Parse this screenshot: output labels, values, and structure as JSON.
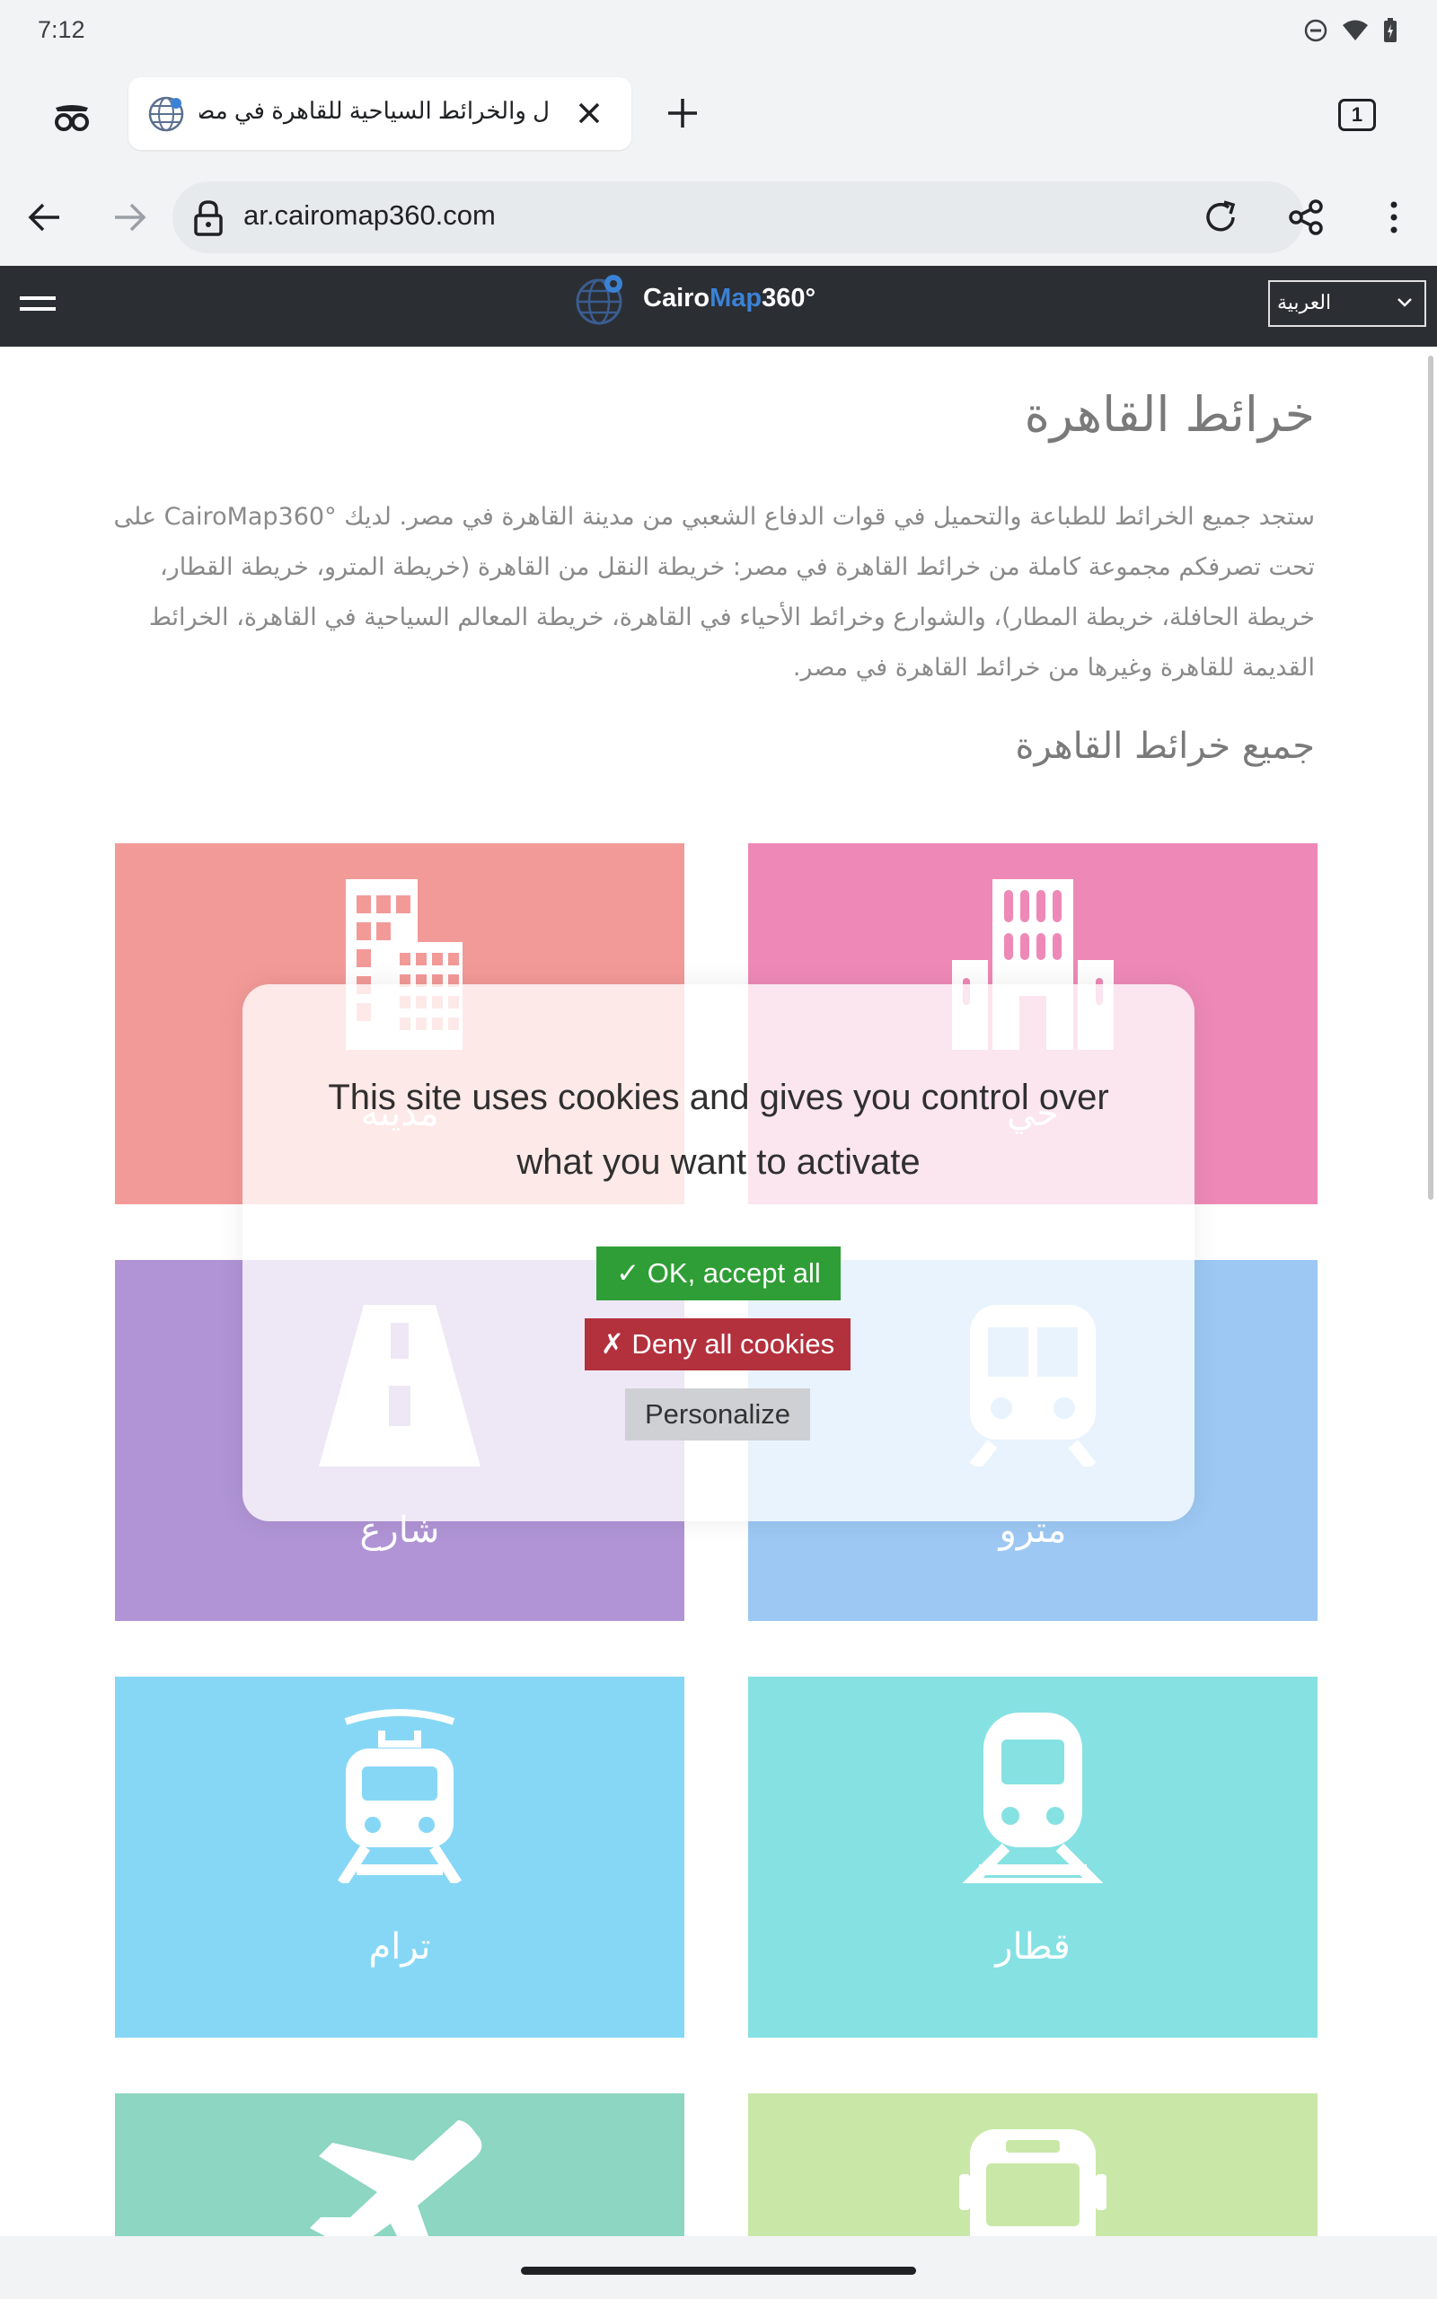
{
  "status_bar": {
    "time": "7:12"
  },
  "browser": {
    "tab_title": "ل والخرائط السياحية للقاهرة في مصر",
    "tab_count": "1",
    "url": "ar.cairomap360.com"
  },
  "site_header": {
    "logo_part1": "Cairo",
    "logo_part2": "Map",
    "logo_part3": "360°",
    "language_selected": "العربية"
  },
  "content": {
    "title": "خرائط القاهرة",
    "intro": "ستجد جميع الخرائط للطباعة والتحميل في قوات الدفاع الشعبي من مدينة القاهرة في مصر. لديك CairoMap360° على تحت تصرفكم مجموعة كاملة من خرائط القاهرة في مصر: خريطة النقل من القاهرة (خريطة المترو، خريطة القطار، خريطة الحافلة، خريطة المطار)، والشوارع وخرائط الأحياء في القاهرة، خريطة المعالم السياحية في القاهرة، الخرائط القديمة للقاهرة وغيرها من خرائط القاهرة في مصر.",
    "section_title": "جميع خرائط القاهرة"
  },
  "tiles": [
    {
      "label": "مدينة",
      "icon": "city-buildings-icon",
      "color": "#f29a98"
    },
    {
      "label": "حي",
      "icon": "district-buildings-icon",
      "color": "#ee89b7"
    },
    {
      "label": "شارع",
      "icon": "street-road-icon",
      "color": "#b094d6"
    },
    {
      "label": "مترو",
      "icon": "metro-train-icon",
      "color": "#9cc8f3"
    },
    {
      "label": "ترام",
      "icon": "tram-icon",
      "color": "#86d7f6"
    },
    {
      "label": "قطار",
      "icon": "train-icon",
      "color": "#86e1e3"
    },
    {
      "label": "",
      "icon": "airplane-icon",
      "color": "#8cd6c2"
    },
    {
      "label": "",
      "icon": "bus-icon",
      "color": "#c9e8a8"
    }
  ],
  "cookie_banner": {
    "message": "This site uses cookies and gives you control over what you want to activate",
    "accept_label": "✓ OK, accept all",
    "deny_label": "✗ Deny all cookies",
    "personalize_label": "Personalize"
  }
}
